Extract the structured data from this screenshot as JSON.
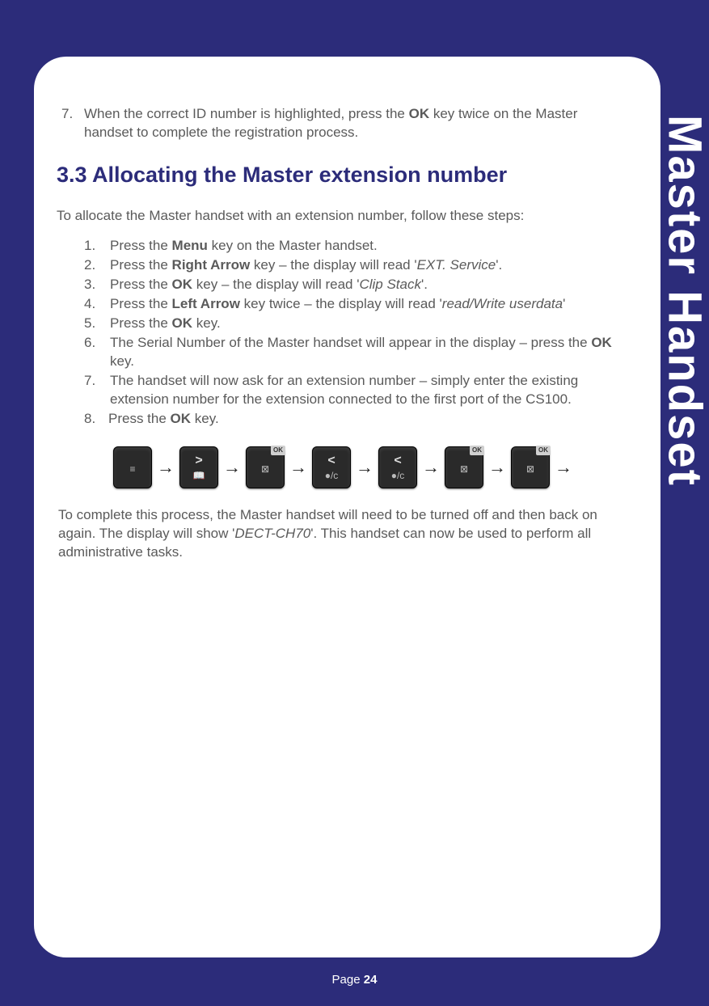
{
  "sideTab": "Master Handset",
  "priorStep": {
    "num": "7.",
    "pre": "When the correct ID number is highlighted, press the ",
    "bold": "OK",
    "post": " key twice on the Master handset to complete the registration process."
  },
  "sectionHeading": "3.3  Allocating the Master extension number",
  "intro": "To allocate the Master handset with an extension number, follow these steps:",
  "steps": [
    {
      "num": "1.",
      "segments": [
        {
          "t": "Press the "
        },
        {
          "t": "Menu",
          "b": true
        },
        {
          "t": " key on the Master handset."
        }
      ]
    },
    {
      "num": "2.",
      "segments": [
        {
          "t": "Press the "
        },
        {
          "t": "Right Arrow",
          "b": true
        },
        {
          "t": " key – the display will read '"
        },
        {
          "t": "EXT. Service",
          "i": true
        },
        {
          "t": "'."
        }
      ]
    },
    {
      "num": "3.",
      "segments": [
        {
          "t": "Press the "
        },
        {
          "t": "OK",
          "b": true
        },
        {
          "t": " key – the display will read '"
        },
        {
          "t": "Clip Stack",
          "i": true
        },
        {
          "t": "'."
        }
      ]
    },
    {
      "num": "4.",
      "segments": [
        {
          "t": "Press the "
        },
        {
          "t": "Left Arrow",
          "b": true
        },
        {
          "t": " key twice – the display will read '"
        },
        {
          "t": "read/Write userdata",
          "i": true
        },
        {
          "t": "'"
        }
      ]
    },
    {
      "num": "5.",
      "segments": [
        {
          "t": "Press the "
        },
        {
          "t": "OK",
          "b": true
        },
        {
          "t": " key."
        }
      ]
    },
    {
      "num": "6.",
      "segments": [
        {
          "t": "The Serial Number of the Master handset will appear in the display – press the "
        },
        {
          "t": "OK",
          "b": true
        },
        {
          "t": " key."
        }
      ]
    },
    {
      "num": "7.",
      "segments": [
        {
          "t": "The handset will now ask for an extension number – simply enter the existing extension number for the extension connected to the first port of the CS100."
        }
      ]
    },
    {
      "num": "8.",
      "segments": [
        {
          "t": "Press the "
        },
        {
          "t": "OK",
          "b": true
        },
        {
          "t": " key."
        }
      ],
      "cls": "num8"
    }
  ],
  "buttonSeq": [
    {
      "name": "menu-key",
      "top": "",
      "bot": "≡"
    },
    {
      "name": "right-arrow-key",
      "top": ">",
      "bot": "📖"
    },
    {
      "name": "ok-key-1",
      "top": "",
      "bot": "⊠",
      "ok": true
    },
    {
      "name": "left-arrow-key-1",
      "top": "<",
      "bot": "●/c"
    },
    {
      "name": "left-arrow-key-2",
      "top": "<",
      "bot": "●/c"
    },
    {
      "name": "ok-key-2",
      "top": "",
      "bot": "⊠",
      "ok": true
    },
    {
      "name": "ok-key-3",
      "top": "",
      "bot": "⊠",
      "ok": true
    }
  ],
  "arrow": "→",
  "finalPara": {
    "pre": "To complete this process, the Master handset will need to be turned off and then back on again. The display will show '",
    "italic": "DECT-CH70",
    "post": "'. This handset can now be used to perform all administrative tasks."
  },
  "footer": {
    "label": "Page ",
    "num": "24"
  }
}
